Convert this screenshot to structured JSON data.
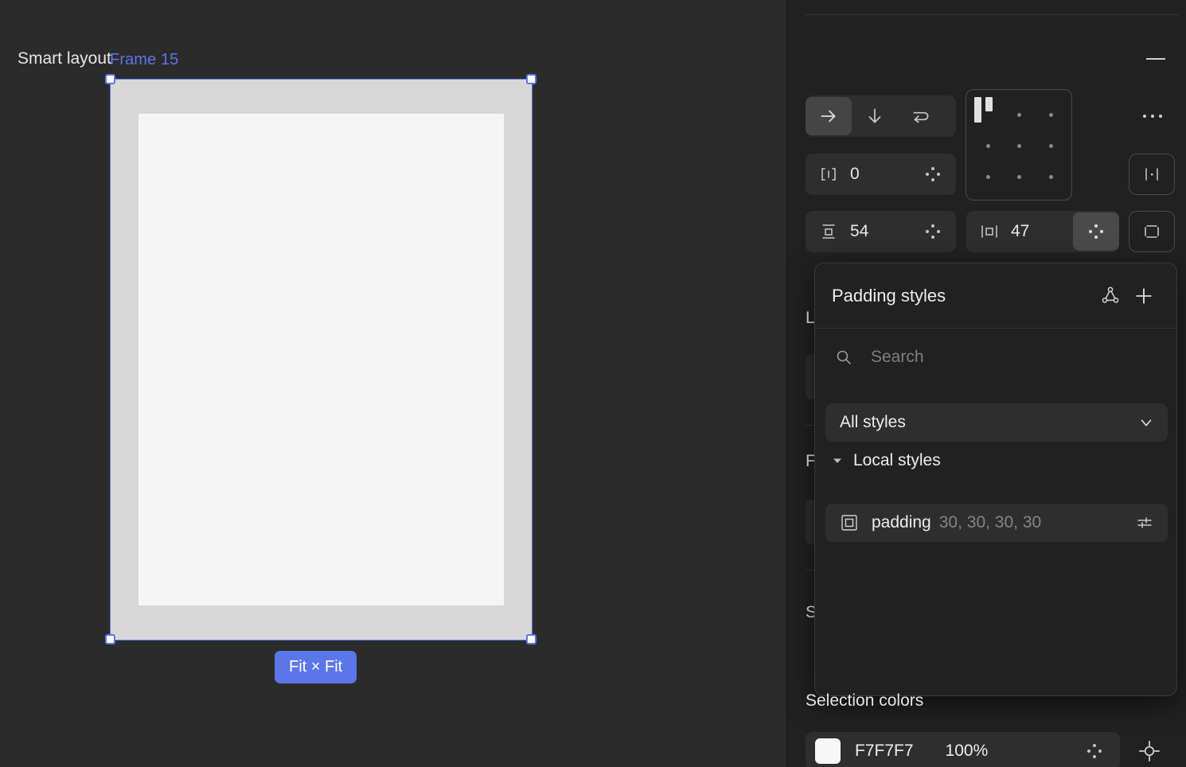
{
  "canvas": {
    "frame_label": "Frame 15",
    "fit_badge": "Fit × Fit",
    "outer_fill": "#D7D7D7",
    "inner_fill": "#F5F5F6",
    "selection_color": "#5B76E8"
  },
  "panel": {
    "smart_layout": {
      "title": "Smart layout",
      "minimize_icon": "minus-icon",
      "more_icon": "ellipsis-icon",
      "direction": {
        "options": [
          {
            "label": "Horizontal",
            "icon": "arrow-right-icon",
            "selected": true
          },
          {
            "label": "Vertical",
            "icon": "arrow-down-icon",
            "selected": false
          },
          {
            "label": "Wrap",
            "icon": "wrap-arrow-icon",
            "selected": false
          }
        ]
      },
      "gap": {
        "icon": "gap-icon",
        "value": "0",
        "dots_icon": "variable-dots-icon"
      },
      "padding_vertical": {
        "icon": "vertical-padding-icon",
        "value": "54",
        "dots_icon": "variable-dots-icon"
      },
      "padding_horizontal": {
        "icon": "horizontal-padding-icon",
        "value": "47",
        "dots_icon": "variable-dots-icon",
        "dots_active": true
      },
      "alignment_grid": {
        "icon": "alignment-grid-icon",
        "selected_cell": "top-left"
      },
      "distribute_button": {
        "icon": "distribute-spacing-icon"
      },
      "padding_sides_button": {
        "icon": "individual-padding-icon"
      }
    },
    "obscured_sections": [
      {
        "label": "L"
      },
      {
        "label": "F"
      },
      {
        "label": "S"
      }
    ],
    "selection_colors": {
      "title": "Selection colors",
      "color": {
        "swatch": "#F7F7F7",
        "hex": "F7F7F7",
        "opacity": "100%",
        "dots_icon": "variable-dots-icon"
      },
      "target_icon": "target-icon"
    }
  },
  "popup": {
    "title": "Padding styles",
    "library_icon": "libraries-icon",
    "add_icon": "plus-icon",
    "search": {
      "icon": "search-icon",
      "value": "",
      "placeholder": "Search"
    },
    "filter_select": {
      "value": "All styles",
      "icon": "chevron-down-icon"
    },
    "group": {
      "label": "Local styles",
      "caret_icon": "caret-down-icon",
      "expanded": true
    },
    "styles": [
      {
        "icon": "padding-style-icon",
        "name": "padding",
        "value": "30, 30, 30, 30",
        "edit_icon": "sliders-icon"
      }
    ]
  }
}
